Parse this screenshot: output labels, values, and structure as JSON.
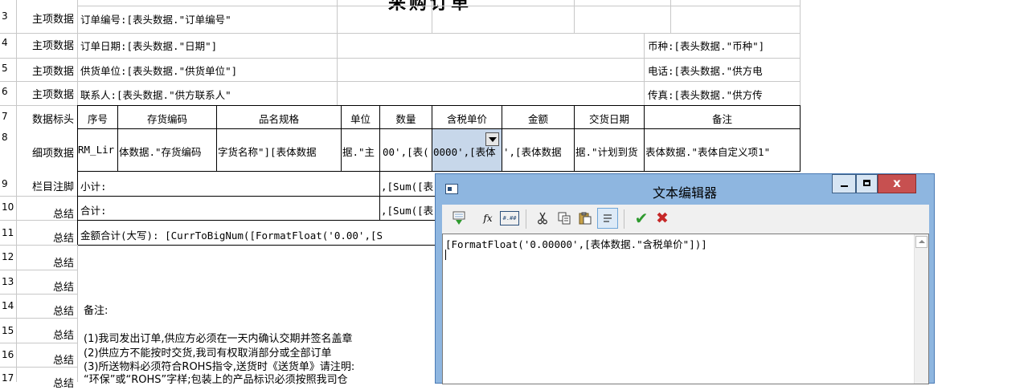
{
  "report": {
    "title": "采购订单",
    "rows": [
      {
        "num": "3",
        "band": "主项数据"
      },
      {
        "num": "4",
        "band": "主项数据"
      },
      {
        "num": "5",
        "band": "主项数据"
      },
      {
        "num": "6",
        "band": "主项数据"
      },
      {
        "num": "7",
        "band": "数据标头"
      },
      {
        "num": "8",
        "band": "细项数据"
      },
      {
        "num": "9",
        "band": "栏目注脚"
      },
      {
        "num": "10",
        "band": "总结"
      },
      {
        "num": "11",
        "band": "总结"
      },
      {
        "num": "12",
        "band": "总结"
      },
      {
        "num": "13",
        "band": "总结"
      },
      {
        "num": "14",
        "band": "总结"
      },
      {
        "num": "15",
        "band": "总结"
      },
      {
        "num": "16",
        "band": "总结"
      },
      {
        "num": "17",
        "band": "总结"
      }
    ],
    "cells": {
      "order_no": "订单编号:[表头数据.\"订单编号\"",
      "order_date": "订单日期:[表头数据.\"日期\"]",
      "currency": "币种:[表头数据.\"币种\"]",
      "supplier": "供货单位:[表头数据.\"供货单位\"]",
      "phone": "电话:[表头数据.\"供方电",
      "contact": "联系人:[表头数据.\"供方联系人\"",
      "fax": "传真:[表头数据.\"供方传",
      "detail_rownum": "RM_Lir",
      "detail_code": "体数据.\"存货编码",
      "detail_name": "字货名称\"][表体数据",
      "detail_unit": "据.\"主",
      "detail_qty": "00',[表(",
      "detail_price": "0000',[表体",
      "detail_amount": "',[表体数据",
      "detail_date": "据.\"计划到货",
      "detail_remark": "表体数据.\"表体自定义项1\"",
      "subtotal_label": "小计:",
      "subtotal_formula": ",[Sum([表",
      "total_label": "合计:",
      "total_formula": ",[Sum([表",
      "bignum": "金额合计(大写): [CurrToBigNum([FormatFloat('0.00',[S",
      "remark_title": "备注:",
      "note1": "(1)我司发出订单,供应方必须在一天内确认交期并签名盖章",
      "note2": "(2)供应方不能按时交货,我司有权取消部分或全部订单",
      "note3": "(3)所送物料必须符合ROHS指令,送货时《送货单》请注明:",
      "note4": "“环保”或“ROHS”字样;包装上的产品标识必须按照我司仓"
    },
    "headers": [
      "序号",
      "存货编码",
      "品名规格",
      "单位",
      "数量",
      "含税单价",
      "金额",
      "交货日期",
      "备注"
    ]
  },
  "dialog": {
    "title": "文本编辑器",
    "toolbar": {
      "insert_field_icon": "insert-field-icon",
      "function_label": "fx",
      "format_label": "#.##",
      "cut_icon": "scissors-icon",
      "copy_icon": "copy-icon",
      "paste_icon": "paste-icon",
      "wrap_icon": "word-wrap-icon",
      "ok_label": "✔",
      "cancel_label": "✖"
    },
    "editor_text": "[FormatFloat('0.00000',[表体数据.\"含税单价\"])]"
  },
  "colors": {
    "dialog_frame": "#8eb6e0",
    "close_button": "#c75050",
    "selected_cell": "#c7d7ea",
    "ok_green": "#2e9a2e",
    "cancel_red": "#c62828"
  }
}
